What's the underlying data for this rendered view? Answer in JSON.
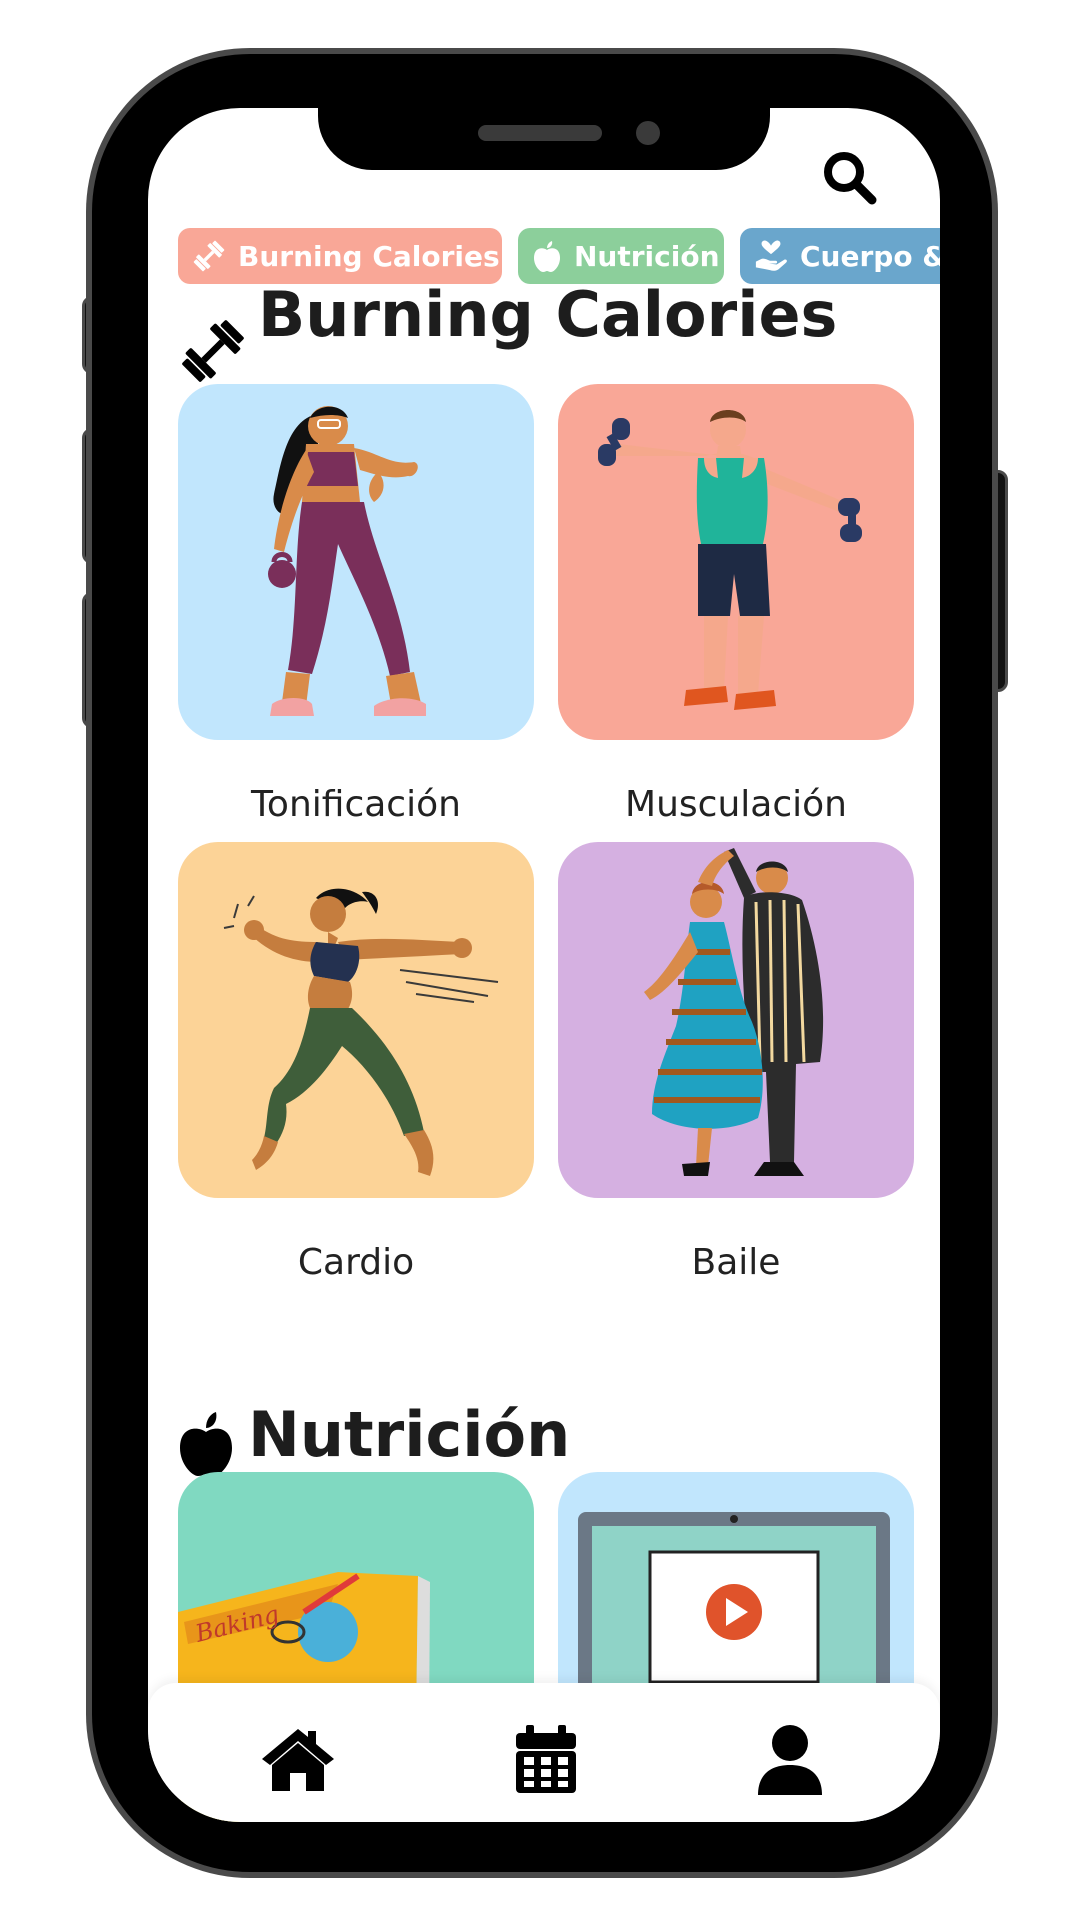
{
  "chips": [
    {
      "label": "Burning Calories",
      "color": "#f9a797",
      "icon": "dumbbell-icon"
    },
    {
      "label": "Nutrición",
      "color": "#8ccf9b",
      "icon": "apple-icon"
    },
    {
      "label": "Cuerpo &",
      "color": "#6aa6cc",
      "icon": "hand-heart-icon"
    }
  ],
  "sections": [
    {
      "title": "Burning Calories",
      "icon": "dumbbell-icon",
      "cards": [
        {
          "label": "Tonificación",
          "bg": "#c1e6fd",
          "illustration": "woman-kettlebell"
        },
        {
          "label": "Musculación",
          "bg": "#f9a797",
          "illustration": "man-dumbbells"
        },
        {
          "label": "Cardio",
          "bg": "#fcd397",
          "illustration": "woman-running"
        },
        {
          "label": "Baile",
          "bg": "#d5b0e1",
          "illustration": "couple-dancing"
        }
      ]
    },
    {
      "title": "Nutrición",
      "icon": "apple-icon",
      "cards": [
        {
          "label": "",
          "bg": "#80d9c1",
          "illustration": "baking-book"
        },
        {
          "label": "",
          "bg": "#c1e6fd",
          "illustration": "video-laptop"
        }
      ]
    }
  ],
  "nav": [
    {
      "name": "home",
      "icon": "home-icon"
    },
    {
      "name": "calendar",
      "icon": "calendar-icon"
    },
    {
      "name": "profile",
      "icon": "user-icon"
    }
  ]
}
